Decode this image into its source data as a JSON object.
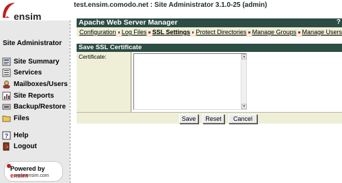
{
  "topbar": {
    "hostline": "test.ensim.comodo.net : Site Administrator 3.1.0-25 (admin)"
  },
  "logo": {
    "word": "ensim"
  },
  "sidebar": {
    "title": "Site Administrator",
    "items": [
      {
        "label": "Site Summary",
        "icon": "site-summary-icon"
      },
      {
        "label": "Services",
        "icon": "services-icon"
      },
      {
        "label": "Mailboxes/Users",
        "icon": "users-icon"
      },
      {
        "label": "Site Reports",
        "icon": "reports-icon"
      },
      {
        "label": "Backup/Restore",
        "icon": "backup-icon"
      },
      {
        "label": "Files",
        "icon": "folder-icon"
      }
    ],
    "items2": [
      {
        "label": "Help",
        "icon": "help-icon"
      },
      {
        "label": "Logout",
        "icon": "logout-icon"
      }
    ],
    "powered": {
      "prefix": "Powered by ",
      "brand": "ensim",
      "url": "www.ensim.com"
    }
  },
  "manager": {
    "title": "Apache Web Server Manager",
    "help": "?",
    "tabs": [
      {
        "label": "Configuration",
        "active": false
      },
      {
        "label": "Log Files",
        "active": false
      },
      {
        "label": "SSL Settings",
        "active": true
      },
      {
        "label": "Protect Directories",
        "active": false
      },
      {
        "label": "Manage Groups",
        "active": false
      },
      {
        "label": "Manage Users",
        "active": false
      }
    ]
  },
  "form": {
    "section_title": "Save SSL Certificate",
    "certificate_label": "Certificate:",
    "certificate_value": "",
    "buttons": {
      "save": "Save",
      "reset": "Reset",
      "cancel": "Cancel"
    }
  },
  "colors": {
    "header": "#2c4c44",
    "panel": "#efefd8",
    "accent": "#c01e1e"
  }
}
